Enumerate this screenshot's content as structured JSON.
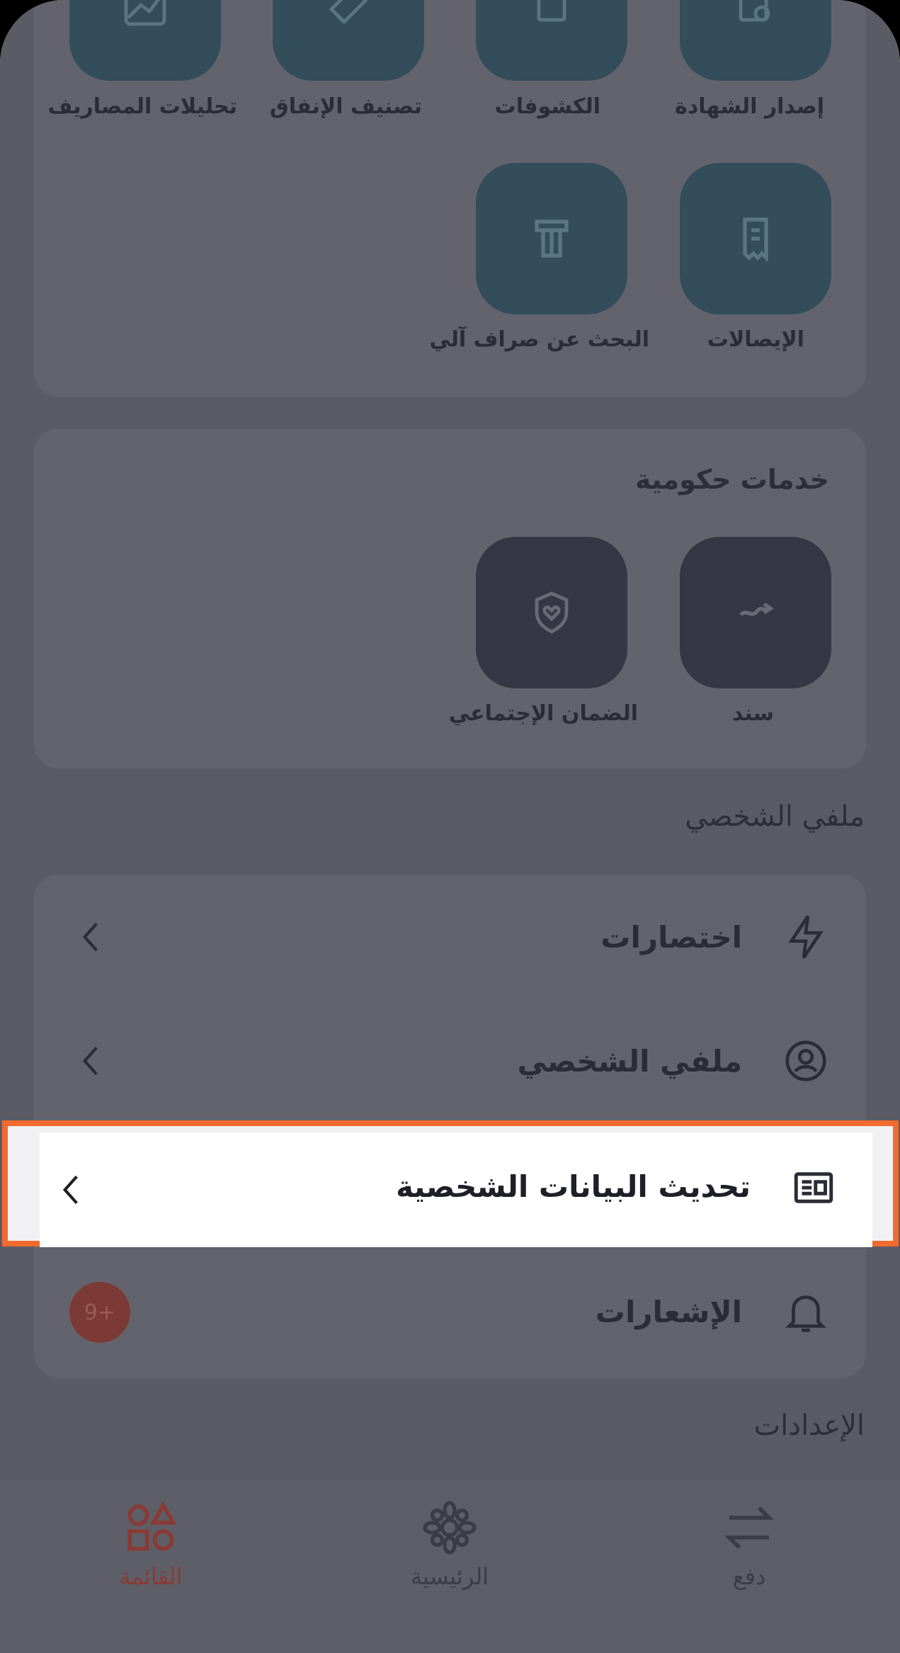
{
  "banking_services": {
    "tiles_row1": [
      {
        "label": "إصدار الشهادة",
        "icon": "certificate-icon"
      },
      {
        "label": "الكشوفات",
        "icon": "statements-icon"
      },
      {
        "label": "تصنيف الإنفاق",
        "icon": "tag-icon"
      },
      {
        "label": "تحليلات المصاريف",
        "icon": "chart-icon"
      }
    ],
    "tiles_row2": [
      {
        "label": "الإيصالات",
        "icon": "receipt-icon"
      },
      {
        "label": "البحث عن صراف آلي",
        "icon": "atm-icon"
      }
    ]
  },
  "government_services": {
    "title": "خدمات حكومية",
    "tiles": [
      {
        "label": "سند",
        "icon": "sanad-icon"
      },
      {
        "label": "الضمان الإجتماعي",
        "icon": "shield-heart-icon"
      }
    ]
  },
  "profile_section": {
    "title": "ملفي الشخصي",
    "items": [
      {
        "label": "اختصارات",
        "icon": "lightning-icon"
      },
      {
        "label": "ملفي الشخصي",
        "icon": "user-circle-icon"
      },
      {
        "label": "تحديث البيانات الشخصية",
        "icon": "id-card-icon"
      },
      {
        "label": "الإشعارات",
        "icon": "bell-icon",
        "badge": "9+"
      }
    ]
  },
  "settings_section": {
    "title": "الإعدادات"
  },
  "bottom_nav": {
    "items": [
      {
        "label": "القائمة",
        "icon": "shapes-icon",
        "active": true
      },
      {
        "label": "الرئيسية",
        "icon": "home-logo-icon",
        "active": false
      },
      {
        "label": "دفع",
        "icon": "transfer-arrows-icon",
        "active": false
      }
    ]
  },
  "colors": {
    "accent": "#f26a2e",
    "active_nav": "#8a3a35",
    "teal_tile": "#334d5a"
  }
}
